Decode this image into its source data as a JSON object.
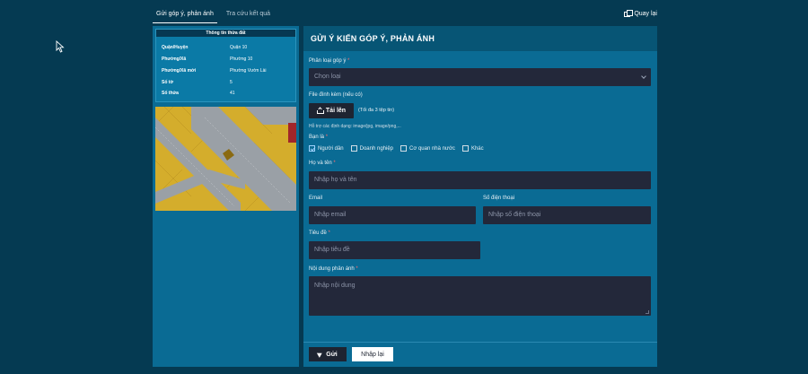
{
  "tabs": [
    {
      "label": "Gửi góp ý, phản ánh",
      "active": true
    },
    {
      "label": "Tra cứu kết quả",
      "active": false
    }
  ],
  "back_label": "Quay lại",
  "info": {
    "title": "Thông tin thửa đất",
    "rows": [
      {
        "key": "Quận/Huyện",
        "value": "Quận 10"
      },
      {
        "key": "Phường/Xã",
        "value": "Phường 10"
      },
      {
        "key": "Phường/Xã mới",
        "value": "Phường Vườn Lài"
      },
      {
        "key": "Số tờ",
        "value": "5"
      },
      {
        "key": "Số thửa",
        "value": "41"
      }
    ]
  },
  "form": {
    "title": "GỬI Ý KIẾN GÓP Ý, PHẢN ÁNH",
    "category": {
      "label": "Phân loại góp ý",
      "required": "*",
      "value": "Chọn loại"
    },
    "attachment": {
      "label": "File đính kèm (nếu có)",
      "button": "Tải lên",
      "note": "(Tối đa 3 tệp tin)",
      "hint": "Hỗ trợ các định dạng: image/jpg, image/png,..."
    },
    "you_are": {
      "label": "Bạn là",
      "required": "*",
      "options": [
        {
          "label": "Người dân",
          "checked": true
        },
        {
          "label": "Doanh nghiệp",
          "checked": false
        },
        {
          "label": "Cơ quan nhà nước",
          "checked": false
        },
        {
          "label": "Khác",
          "checked": false
        }
      ]
    },
    "fullname": {
      "label": "Họ và tên",
      "required": "*",
      "placeholder": "Nhập họ và tên"
    },
    "email": {
      "label": "Email",
      "placeholder": "Nhập email"
    },
    "phone": {
      "label": "Số điện thoại",
      "placeholder": "Nhập số điện thoại"
    },
    "subject": {
      "label": "Tiêu đề",
      "required": "*",
      "placeholder": "Nhập tiêu đề"
    },
    "content": {
      "label": "Nội dung phản ánh",
      "required": "*",
      "placeholder": "Nhập nội dung"
    },
    "send_label": "Gửi",
    "reset_label": "Nhập lại"
  },
  "icons": {
    "back": "window-icon",
    "upload": "upload-icon",
    "send": "send-icon",
    "cursor": "cursor-icon"
  }
}
